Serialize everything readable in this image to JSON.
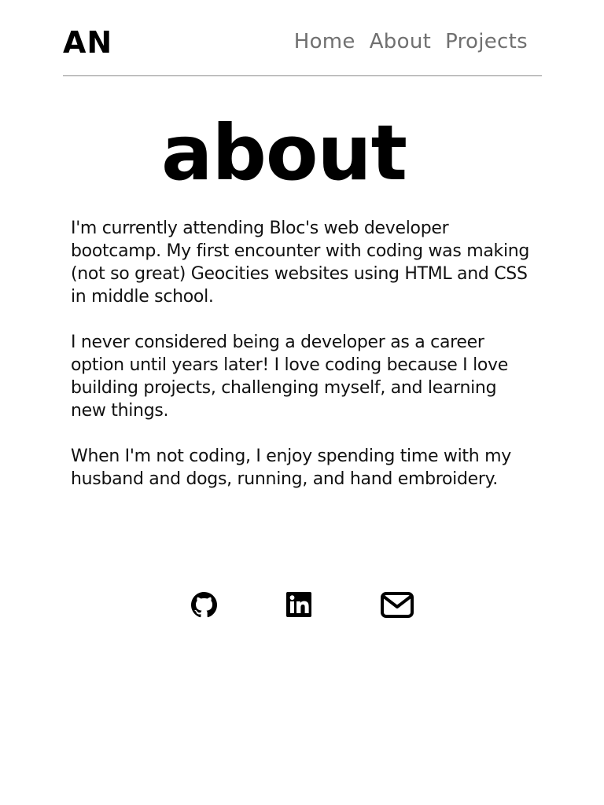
{
  "header": {
    "logo": "AN",
    "nav": [
      {
        "label": "Home"
      },
      {
        "label": "About"
      },
      {
        "label": "Projects"
      }
    ]
  },
  "main": {
    "title": "about",
    "paragraphs": [
      "I'm currently attending Bloc's web developer bootcamp. My first encounter with coding was making (not so great) Geocities websites using HTML and CSS in middle school.",
      "I never considered being a developer as a career option until years later! I love coding because I love building projects, challenging myself, and learning new things.",
      "When I'm not coding, I enjoy spending time with my husband and dogs, running, and hand embroidery."
    ]
  },
  "social": {
    "links": [
      {
        "icon": "github-icon"
      },
      {
        "icon": "linkedin-icon"
      },
      {
        "icon": "envelope-icon"
      }
    ]
  },
  "colors": {
    "text": "#000000",
    "nav": "#707070",
    "divider": "#8a8a8a",
    "background": "#ffffff"
  }
}
